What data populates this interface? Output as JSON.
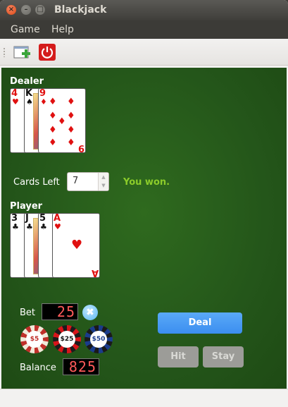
{
  "window": {
    "title": "Blackjack"
  },
  "menu": {
    "game": "Game",
    "help": "Help"
  },
  "toolbar": {
    "new_icon": "new-game-icon",
    "quit_icon": "power-icon"
  },
  "dealer": {
    "label": "Dealer",
    "cards": [
      {
        "rank": "4",
        "suit": "♥",
        "color": "red"
      },
      {
        "rank": "K",
        "suit": "♠",
        "color": "black"
      },
      {
        "rank": "9",
        "suit": "♦",
        "color": "red"
      }
    ]
  },
  "cards_left": {
    "label": "Cards Left",
    "value": "7"
  },
  "status": "You won.",
  "player": {
    "label": "Player",
    "cards": [
      {
        "rank": "3",
        "suit": "♣",
        "color": "black"
      },
      {
        "rank": "J",
        "suit": "♣",
        "color": "black"
      },
      {
        "rank": "5",
        "suit": "♣",
        "color": "black"
      },
      {
        "rank": "A",
        "suit": "♥",
        "color": "red"
      }
    ]
  },
  "bet": {
    "label": "Bet",
    "value": "25"
  },
  "chips": [
    {
      "label": "$5",
      "color": "#c0302a"
    },
    {
      "label": "$25",
      "color": "#d8151a"
    },
    {
      "label": "$50",
      "color": "#1a3c8c"
    }
  ],
  "balance": {
    "label": "Balance",
    "value": "825"
  },
  "buttons": {
    "deal": "Deal",
    "hit": "Hit",
    "stay": "Stay"
  },
  "colors": {
    "table": "#24561a",
    "accent": "#3c8ef0",
    "status": "#8ccc2a",
    "led": "#ff5a5a"
  }
}
